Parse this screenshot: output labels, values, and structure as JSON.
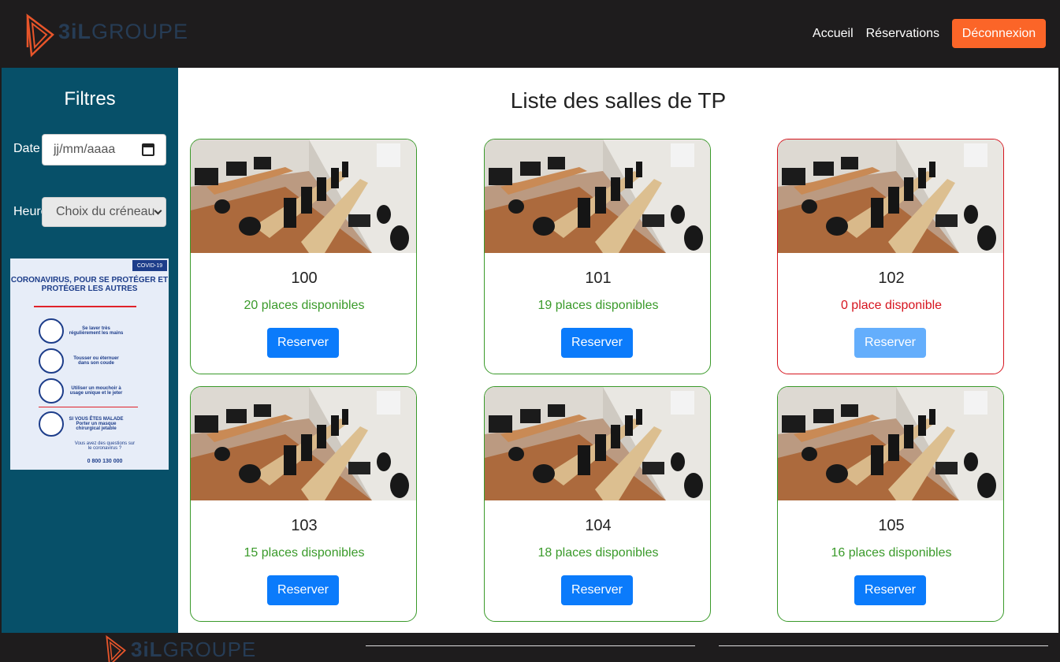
{
  "header": {
    "logo": {
      "prefix": "3iL",
      "suffix": "GROUPE"
    },
    "nav": {
      "home": "Accueil",
      "reservations": "Réservations",
      "logout": "Déconnexion"
    }
  },
  "sidebar": {
    "title": "Filtres",
    "date_label": "Date",
    "date_placeholder": "jj/mm/aaaa",
    "hour_label": "Heure",
    "hour_select": "Choix du créneau"
  },
  "poster": {
    "badge": "COVID-19",
    "title": "CORONAVIRUS, POUR SE PROTÉGER ET PROTÉGER LES AUTRES",
    "items": [
      "Se laver très régulièrement les mains",
      "Tousser ou éternuer dans son coude",
      "Utiliser un mouchoir à usage unique et le jeter",
      "SI VOUS ÊTES MALADE Porter un masque chirurgical jetable"
    ],
    "question": "Vous avez des questions sur le coronavirus ?",
    "phone": "0 800 130 000"
  },
  "main": {
    "title": "Liste des salles de TP",
    "rooms": [
      {
        "name": "100",
        "places": "20 places disponibles",
        "button": "Reserver",
        "status": "available"
      },
      {
        "name": "101",
        "places": "19 places disponibles",
        "button": "Reserver",
        "status": "available"
      },
      {
        "name": "102",
        "places": "0 place disponible",
        "button": "Reserver",
        "status": "full"
      },
      {
        "name": "103",
        "places": "15 places disponibles",
        "button": "Reserver",
        "status": "available"
      },
      {
        "name": "104",
        "places": "18 places disponibles",
        "button": "Reserver",
        "status": "available"
      },
      {
        "name": "105",
        "places": "16 places disponibles",
        "button": "Reserver",
        "status": "available"
      }
    ]
  },
  "colors": {
    "header_bg": "#1e1c1d",
    "sidebar_bg": "#075069",
    "logout": "#fb6528",
    "available": "#3a9a2a",
    "full": "#d6141e",
    "button": "#0b7bfb",
    "button_disabled": "#64aefc"
  }
}
